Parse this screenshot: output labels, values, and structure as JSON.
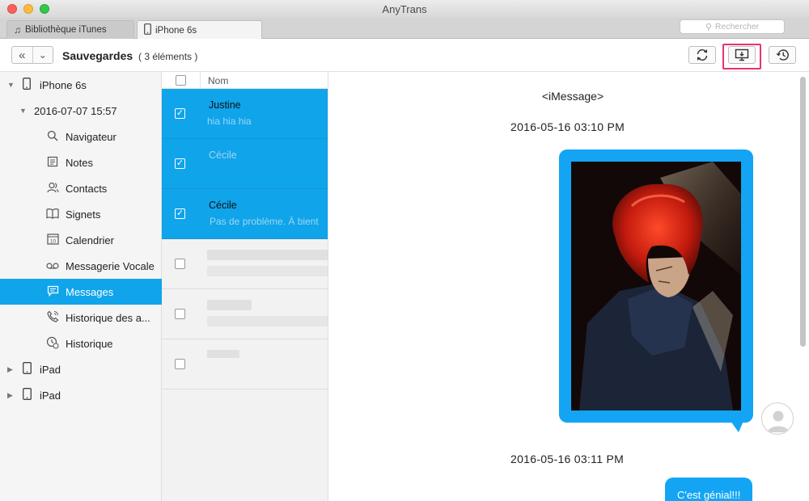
{
  "window": {
    "title": "AnyTrans"
  },
  "tabs": [
    {
      "label": "Bibliothèque iTunes",
      "icon": "music-note-icon"
    },
    {
      "label": "iPhone 6s",
      "icon": "iphone-icon"
    }
  ],
  "search": {
    "placeholder": "Rechercher"
  },
  "toolbar": {
    "title": "Sauvegardes",
    "count": "( 3 éléments )",
    "buttons": [
      "refresh-icon",
      "export-to-computer-icon",
      "history-icon"
    ],
    "highlight_color": "#e8336d"
  },
  "sidebar": {
    "device": "iPhone 6s",
    "backup": "2016-07-07 15:57",
    "items": [
      {
        "label": "Navigateur",
        "icon": "search-icon"
      },
      {
        "label": "Notes",
        "icon": "note-icon"
      },
      {
        "label": "Contacts",
        "icon": "contacts-icon"
      },
      {
        "label": "Signets",
        "icon": "book-icon"
      },
      {
        "label": "Calendrier",
        "icon": "calendar-icon"
      },
      {
        "label": "Messagerie Vocale",
        "icon": "voicemail-icon"
      },
      {
        "label": "Messages",
        "icon": "message-icon",
        "active": true
      },
      {
        "label": "Historique des a...",
        "icon": "phone-icon"
      },
      {
        "label": "Historique",
        "icon": "history-icon"
      }
    ],
    "other_devices": [
      "iPad",
      "iPad"
    ],
    "accent": "#10a4ea",
    "calendar_day": "10"
  },
  "list": {
    "header": "Nom",
    "rows": [
      {
        "name": "Justine",
        "preview": "hia hia hia",
        "checked": true
      },
      {
        "name": "Cécile",
        "preview": "",
        "checked": true
      },
      {
        "name": "Cécile",
        "preview": "Pas de problème. À bient",
        "checked": true
      },
      {
        "name": "",
        "preview": "",
        "checked": false
      },
      {
        "name": "",
        "preview": "",
        "checked": false
      },
      {
        "name": "",
        "preview": "",
        "checked": false
      }
    ]
  },
  "conversation": {
    "title": "<iMessage>",
    "timestamps": [
      "2016-05-16 03:10 PM",
      "2016-05-16 03:11 PM"
    ],
    "text_bubble": "C'est génial!!!",
    "bubble_color": "#13a5f3"
  }
}
